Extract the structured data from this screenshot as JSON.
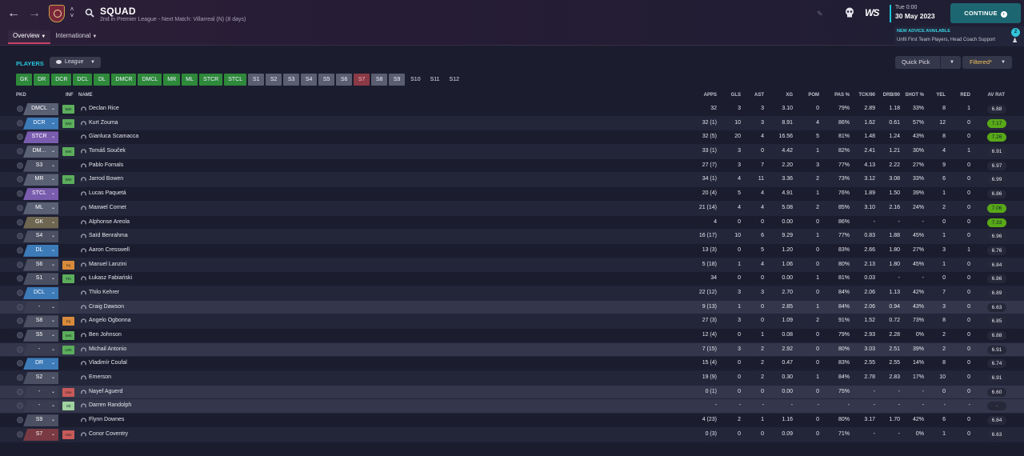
{
  "header": {
    "title": "SQUAD",
    "subtitle": "2nd in Premier League - Next Match: Villarreal (N) (8 days)",
    "tabs": [
      {
        "label": "Overview"
      },
      {
        "label": "International"
      }
    ],
    "date_time": "Tue 0:00",
    "date_day": "30 May 2023",
    "continue_label": "CONTINUE",
    "advice_title": "NEW ADVICE AVAILABLE",
    "advice_text": "Unfit First Team Players, Head Coach Support",
    "advice_count": "2",
    "logo_text": "WS",
    "icons": {
      "back": "back-arrow-icon",
      "forward": "forward-arrow-icon",
      "search": "search-icon",
      "edit": "pencil-icon",
      "social": "skull-icon"
    }
  },
  "filters": {
    "section_label": "PLAYERS",
    "league_label": "League",
    "quick_pick_label": "Quick Pick",
    "filtered_label": "Filtered*",
    "positions": [
      {
        "label": "GK",
        "state": "green"
      },
      {
        "label": "DR",
        "state": "green"
      },
      {
        "label": "DCR",
        "state": "green"
      },
      {
        "label": "DCL",
        "state": "green"
      },
      {
        "label": "DL",
        "state": "green"
      },
      {
        "label": "DMCR",
        "state": "green"
      },
      {
        "label": "DMCL",
        "state": "green"
      },
      {
        "label": "MR",
        "state": "green"
      },
      {
        "label": "ML",
        "state": "green"
      },
      {
        "label": "STCR",
        "state": "green"
      },
      {
        "label": "STCL",
        "state": "green"
      },
      {
        "label": "S1",
        "state": "grey"
      },
      {
        "label": "S2",
        "state": "grey"
      },
      {
        "label": "S3",
        "state": "grey"
      },
      {
        "label": "S4",
        "state": "grey"
      },
      {
        "label": "S5",
        "state": "grey"
      },
      {
        "label": "S6",
        "state": "grey"
      },
      {
        "label": "S7",
        "state": "red"
      },
      {
        "label": "S8",
        "state": "grey"
      },
      {
        "label": "S9",
        "state": "grey"
      },
      {
        "label": "S10",
        "state": "plain"
      },
      {
        "label": "S11",
        "state": "plain"
      },
      {
        "label": "S12",
        "state": "plain"
      }
    ]
  },
  "table": {
    "columns": {
      "pkd": "PKD",
      "inf": "INF",
      "name": "NAME",
      "apps": "APPS",
      "gls": "GLS",
      "ast": "AST",
      "xg": "XG",
      "pom": "POM",
      "pas": "PAS %",
      "tck": "TCK/90",
      "drb": "DRB/90",
      "shot": "SHOT %",
      "yel": "YEL",
      "red": "RED",
      "avr": "AV RAT"
    },
    "rows": [
      {
        "pos": "DMCL",
        "pos_color": "#5b6175",
        "inf": "Wnt",
        "inf_color": "#5cae5c",
        "name": "Declan Rice",
        "apps": "32",
        "gls": "3",
        "ast": "3",
        "xg": "3.10",
        "pom": "0",
        "pas": "79%",
        "tck": "2.89",
        "drb": "1.18",
        "shot": "33%",
        "yel": "8",
        "red": "1",
        "avr": "6.88",
        "rating_style": "normal"
      },
      {
        "pos": "DCR",
        "pos_color": "#3d7ab8",
        "inf": "Wnt",
        "inf_color": "#5cae5c",
        "name": "Kurt Zouma",
        "apps": "32 (1)",
        "gls": "10",
        "ast": "3",
        "xg": "8.91",
        "pom": "4",
        "pas": "86%",
        "tck": "1.62",
        "drb": "0.61",
        "shot": "57%",
        "yel": "12",
        "red": "0",
        "avr": "7.17",
        "rating_style": "good"
      },
      {
        "pos": "STCR",
        "pos_color": "#7a5cae",
        "inf": "",
        "inf_color": "",
        "name": "Gianluca Scamacca",
        "apps": "32 (5)",
        "gls": "20",
        "ast": "4",
        "xg": "16.56",
        "pom": "5",
        "pas": "81%",
        "tck": "1.48",
        "drb": "1.24",
        "shot": "43%",
        "yel": "8",
        "red": "0",
        "avr": "7.26",
        "rating_style": "good"
      },
      {
        "pos": "DM...",
        "pos_color": "#5b6175",
        "inf": "Wnt",
        "inf_color": "#5cae5c",
        "name": "Tomáš Souček",
        "apps": "33 (1)",
        "gls": "3",
        "ast": "0",
        "xg": "4.42",
        "pom": "1",
        "pas": "82%",
        "tck": "2.41",
        "drb": "1.21",
        "shot": "30%",
        "yel": "4",
        "red": "1",
        "avr": "6.91",
        "rating_style": "normal"
      },
      {
        "pos": "S3",
        "pos_color": "#4b4f62",
        "inf": "",
        "inf_color": "",
        "name": "Pablo Fornals",
        "apps": "27 (7)",
        "gls": "3",
        "ast": "7",
        "xg": "2.20",
        "pom": "3",
        "pas": "77%",
        "tck": "4.13",
        "drb": "2.22",
        "shot": "27%",
        "yel": "9",
        "red": "0",
        "avr": "6.97",
        "rating_style": "normal"
      },
      {
        "pos": "MR",
        "pos_color": "#5b6175",
        "inf": "Wnt",
        "inf_color": "#5cae5c",
        "name": "Jarrod Bowen",
        "apps": "34 (1)",
        "gls": "4",
        "ast": "11",
        "xg": "3.36",
        "pom": "2",
        "pas": "73%",
        "tck": "3.12",
        "drb": "3.08",
        "shot": "33%",
        "yel": "6",
        "red": "0",
        "avr": "6.99",
        "rating_style": "normal"
      },
      {
        "pos": "STCL",
        "pos_color": "#7a5cae",
        "inf": "",
        "inf_color": "",
        "name": "Lucas Paquetá",
        "apps": "20 (4)",
        "gls": "5",
        "ast": "4",
        "xg": "4.91",
        "pom": "1",
        "pas": "76%",
        "tck": "1.89",
        "drb": "1.50",
        "shot": "39%",
        "yel": "1",
        "red": "0",
        "avr": "6.86",
        "rating_style": "normal"
      },
      {
        "pos": "ML",
        "pos_color": "#5b6175",
        "inf": "",
        "inf_color": "",
        "name": "Maxwel Cornet",
        "apps": "21 (14)",
        "gls": "4",
        "ast": "4",
        "xg": "5.08",
        "pom": "2",
        "pas": "85%",
        "tck": "3.10",
        "drb": "2.16",
        "shot": "24%",
        "yel": "2",
        "red": "0",
        "avr": "7.06",
        "rating_style": "good"
      },
      {
        "pos": "GK",
        "pos_color": "#6e6650",
        "inf": "",
        "inf_color": "",
        "name": "Alphonse Areola",
        "apps": "4",
        "gls": "0",
        "ast": "0",
        "xg": "0.00",
        "pom": "0",
        "pas": "86%",
        "tck": "-",
        "drb": "-",
        "shot": "-",
        "yel": "0",
        "red": "0",
        "avr": "7.33",
        "rating_style": "good"
      },
      {
        "pos": "S4",
        "pos_color": "#4b4f62",
        "inf": "",
        "inf_color": "",
        "name": "Saïd Benrahma",
        "apps": "16 (17)",
        "gls": "10",
        "ast": "6",
        "xg": "9.29",
        "pom": "1",
        "pas": "77%",
        "tck": "0.83",
        "drb": "1.88",
        "shot": "45%",
        "yel": "1",
        "red": "0",
        "avr": "6.96",
        "rating_style": "normal"
      },
      {
        "pos": "DL",
        "pos_color": "#3d7ab8",
        "inf": "",
        "inf_color": "",
        "name": "Aaron Cresswell",
        "apps": "13 (3)",
        "gls": "0",
        "ast": "5",
        "xg": "1.20",
        "pom": "0",
        "pas": "83%",
        "tck": "2.66",
        "drb": "1.80",
        "shot": "27%",
        "yel": "3",
        "red": "1",
        "avr": "6.76",
        "rating_style": "normal"
      },
      {
        "pos": "S6",
        "pos_color": "#4b4f62",
        "inf": "Inj",
        "inf_color": "#d98a3a",
        "name": "Manuel Lanzini",
        "apps": "5 (18)",
        "gls": "1",
        "ast": "4",
        "xg": "1.06",
        "pom": "0",
        "pas": "80%",
        "tck": "2.13",
        "drb": "1.80",
        "shot": "45%",
        "yel": "1",
        "red": "0",
        "avr": "6.84",
        "rating_style": "normal"
      },
      {
        "pos": "S1",
        "pos_color": "#4b4f62",
        "inf": "Trn",
        "inf_color": "#5cae5c",
        "name": "Łukasz Fabiański",
        "apps": "34",
        "gls": "0",
        "ast": "0",
        "xg": "0.00",
        "pom": "1",
        "pas": "81%",
        "tck": "0.03",
        "drb": "-",
        "shot": "-",
        "yel": "0",
        "red": "0",
        "avr": "6.86",
        "rating_style": "normal"
      },
      {
        "pos": "DCL",
        "pos_color": "#3d7ab8",
        "inf": "",
        "inf_color": "",
        "name": "Thilo Kehrer",
        "apps": "22 (12)",
        "gls": "3",
        "ast": "3",
        "xg": "2.70",
        "pom": "0",
        "pas": "84%",
        "tck": "2.06",
        "drb": "1.13",
        "shot": "42%",
        "yel": "7",
        "red": "0",
        "avr": "6.89",
        "rating_style": "normal"
      },
      {
        "pos": "-",
        "pos_color": "#3a3d50",
        "inf": "",
        "inf_color": "",
        "name": "Craig Dawson",
        "apps": "9 (13)",
        "gls": "1",
        "ast": "0",
        "xg": "2.85",
        "pom": "1",
        "pas": "84%",
        "tck": "2.06",
        "drb": "0.94",
        "shot": "43%",
        "yel": "3",
        "red": "0",
        "avr": "6.63",
        "rating_style": "normal"
      },
      {
        "pos": "S8",
        "pos_color": "#4b4f62",
        "inf": "Inj",
        "inf_color": "#d98a3a",
        "name": "Angelo Ogbonna",
        "apps": "27 (3)",
        "gls": "3",
        "ast": "0",
        "xg": "1.09",
        "pom": "2",
        "pas": "91%",
        "tck": "1.52",
        "drb": "0.72",
        "shot": "73%",
        "yel": "8",
        "red": "0",
        "avr": "6.85",
        "rating_style": "normal"
      },
      {
        "pos": "S5",
        "pos_color": "#4b4f62",
        "inf": "Wnt",
        "inf_color": "#5cae5c",
        "name": "Ben Johnson",
        "apps": "12 (4)",
        "gls": "0",
        "ast": "1",
        "xg": "0.08",
        "pom": "0",
        "pas": "79%",
        "tck": "2.93",
        "drb": "2.28",
        "shot": "0%",
        "yel": "2",
        "red": "0",
        "avr": "6.88",
        "rating_style": "normal"
      },
      {
        "pos": "-",
        "pos_color": "#3a3d50",
        "inf": "Unh",
        "inf_color": "#5cae5c",
        "name": "Michail Antonio",
        "apps": "7 (15)",
        "gls": "3",
        "ast": "2",
        "xg": "2.92",
        "pom": "0",
        "pas": "80%",
        "tck": "3.03",
        "drb": "2.51",
        "shot": "39%",
        "yel": "2",
        "red": "0",
        "avr": "6.91",
        "rating_style": "normal"
      },
      {
        "pos": "DR",
        "pos_color": "#3d7ab8",
        "inf": "",
        "inf_color": "",
        "name": "Vladimír Coufal",
        "apps": "15 (4)",
        "gls": "0",
        "ast": "2",
        "xg": "0.47",
        "pom": "0",
        "pas": "83%",
        "tck": "2.55",
        "drb": "2.55",
        "shot": "14%",
        "yel": "8",
        "red": "0",
        "avr": "6.74",
        "rating_style": "normal"
      },
      {
        "pos": "S2",
        "pos_color": "#4b4f62",
        "inf": "",
        "inf_color": "",
        "name": "Emerson",
        "apps": "19 (9)",
        "gls": "0",
        "ast": "2",
        "xg": "0.30",
        "pom": "1",
        "pas": "84%",
        "tck": "2.78",
        "drb": "2.83",
        "shot": "17%",
        "yel": "10",
        "red": "0",
        "avr": "6.91",
        "rating_style": "normal"
      },
      {
        "pos": "-",
        "pos_color": "#3a3d50",
        "inf": "Unv",
        "inf_color": "#c95a5a",
        "name": "Nayef Aguerd",
        "apps": "0 (1)",
        "gls": "0",
        "ast": "0",
        "xg": "0.00",
        "pom": "0",
        "pas": "75%",
        "tck": "-",
        "drb": "-",
        "shot": "-",
        "yel": "0",
        "red": "0",
        "avr": "6.60",
        "rating_style": "normal"
      },
      {
        "pos": "-",
        "pos_color": "#3a3d50",
        "inf": "Slt",
        "inf_color": "#9fd4a0",
        "name": "Darren Randolph",
        "apps": "-",
        "gls": "-",
        "ast": "-",
        "xg": "-",
        "pom": "-",
        "pas": "-",
        "tck": "-",
        "drb": "-",
        "shot": "-",
        "yel": "-",
        "red": "-",
        "avr": "-",
        "rating_style": "dash"
      },
      {
        "pos": "S9",
        "pos_color": "#4b4f62",
        "inf": "",
        "inf_color": "",
        "name": "Flynn Downes",
        "apps": "4 (23)",
        "gls": "2",
        "ast": "1",
        "xg": "1.16",
        "pom": "0",
        "pas": "80%",
        "tck": "3.17",
        "drb": "1.70",
        "shot": "42%",
        "yel": "6",
        "red": "0",
        "avr": "6.84",
        "rating_style": "normal"
      },
      {
        "pos": "S7",
        "pos_color": "#7a3a44",
        "inf": "Unv",
        "inf_color": "#c95a5a",
        "name": "Conor Coventry",
        "apps": "0 (3)",
        "gls": "0",
        "ast": "0",
        "xg": "0.09",
        "pom": "0",
        "pas": "71%",
        "tck": "-",
        "drb": "-",
        "shot": "0%",
        "yel": "1",
        "red": "0",
        "avr": "6.63",
        "rating_style": "normal"
      }
    ]
  }
}
